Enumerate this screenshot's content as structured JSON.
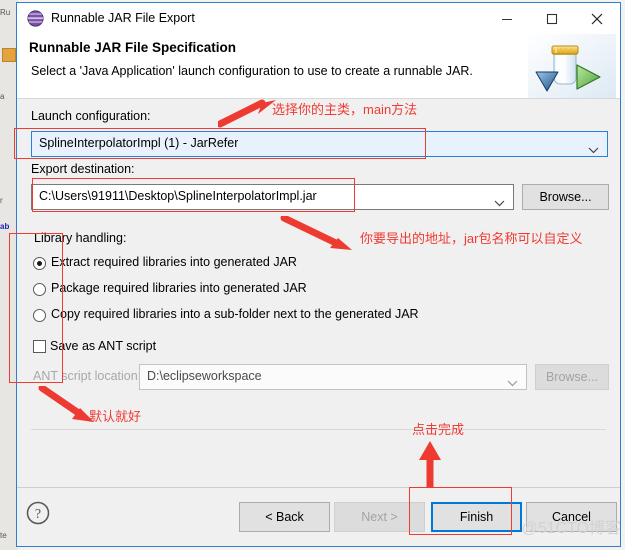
{
  "background": {
    "tab_labels": [
      "Ru",
      "a",
      "r",
      "ab",
      "te"
    ]
  },
  "window": {
    "title": "Runnable JAR File Export",
    "icon": "export-sphere-icon",
    "minimize_label": "—",
    "maximize_label": "□",
    "close_label": "✕"
  },
  "header": {
    "title": "Runnable JAR File Specification",
    "description": "Select a 'Java Application' launch configuration to use to create a runnable JAR.",
    "banner_icon": "jar-with-green-play-icon"
  },
  "form": {
    "launch_configuration": {
      "label": "Launch configuration:",
      "value": "SplineInterpolatorImpl (1) - JarRefer"
    },
    "export_destination": {
      "label": "Export destination:",
      "value": "C:\\Users\\91911\\Desktop\\SplineInterpolatorImpl.jar",
      "browse_label": "Browse..."
    },
    "library_handling": {
      "label": "Library handling:",
      "options": [
        {
          "label": "Extract required libraries into generated JAR",
          "selected": true
        },
        {
          "label": "Package required libraries into generated JAR",
          "selected": false
        },
        {
          "label": "Copy required libraries into a sub-folder next to the generated JAR",
          "selected": false
        }
      ]
    },
    "save_ant": {
      "label": "Save as ANT script",
      "checked": false
    },
    "ant_location": {
      "label": "ANT script location:",
      "value": "D:\\eclipseworkspace",
      "browse_label": "Browse...",
      "enabled": false
    }
  },
  "footer": {
    "help_icon": "question-mark-icon",
    "back_label": "< Back",
    "next_label": "Next >",
    "finish_label": "Finish",
    "cancel_label": "Cancel"
  },
  "annotations": {
    "a1": "选择你的主类，main方法",
    "a2": "你要导出的地址，jar包名称可以自定义",
    "a3": "默认就好",
    "a4": "点击完成",
    "color": "#f03a32"
  },
  "watermark": "@51CTO博客",
  "colors": {
    "accent_blue": "#0078d7",
    "dialog_border": "#2f7fd1",
    "annotation_red": "#ef3b33",
    "panel_bg": "#f0f0f0"
  }
}
